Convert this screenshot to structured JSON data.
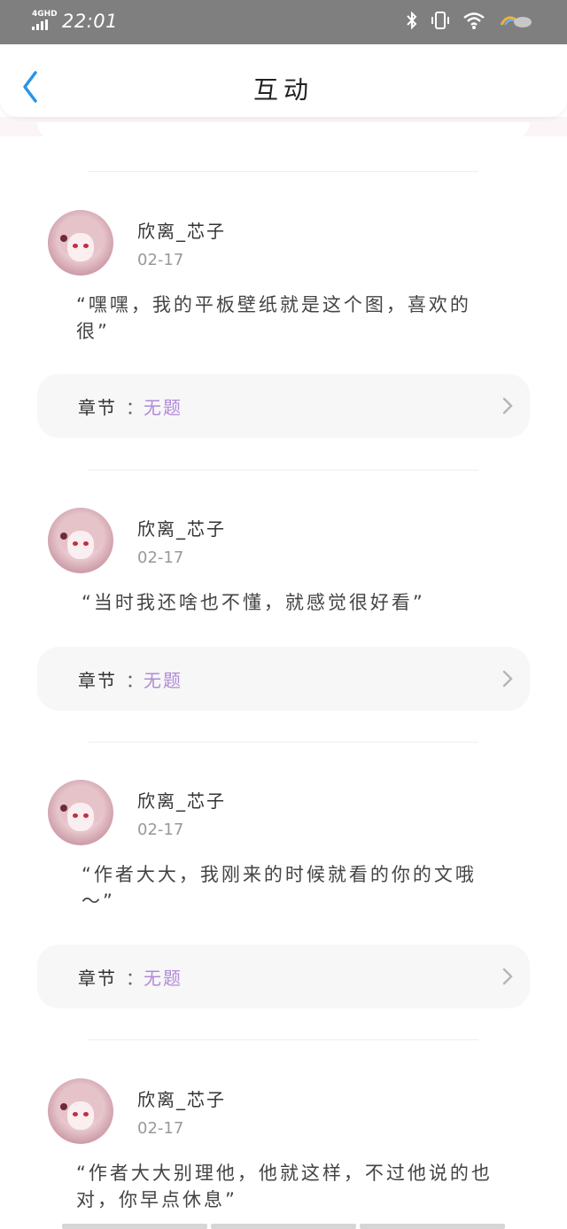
{
  "status": {
    "network": "4GHD",
    "time": "22:01",
    "icons": [
      "bluetooth-icon",
      "vibrate-icon",
      "wifi-icon",
      "weather-icon"
    ]
  },
  "header": {
    "title": "互动",
    "back_icon": "chevron-left-icon",
    "accent": "#2a95e8"
  },
  "comments": [
    {
      "user": "欣离_芯子",
      "date": "02-17",
      "text": "“嘿嘿，我的平板壁纸就是这个图，喜欢的很”",
      "chapter_label": "章节",
      "chapter_colon": "：",
      "chapter_value": "无题"
    },
    {
      "user": "欣离_芯子",
      "date": "02-17",
      "text": "“当时我还啥也不懂，就感觉很好看”",
      "chapter_label": "章节",
      "chapter_colon": "：",
      "chapter_value": "无题"
    },
    {
      "user": "欣离_芯子",
      "date": "02-17",
      "text": "“作者大大，我刚来的时候就看的你的文哦～”",
      "chapter_label": "章节",
      "chapter_colon": "：",
      "chapter_value": "无题"
    },
    {
      "user": "欣离_芯子",
      "date": "02-17",
      "text": "“作者大大别理他，他就这样，不过他说的也对，你早点休息”"
    }
  ],
  "colors": {
    "chapter_value": "#b08ad8",
    "date": "#999999"
  }
}
